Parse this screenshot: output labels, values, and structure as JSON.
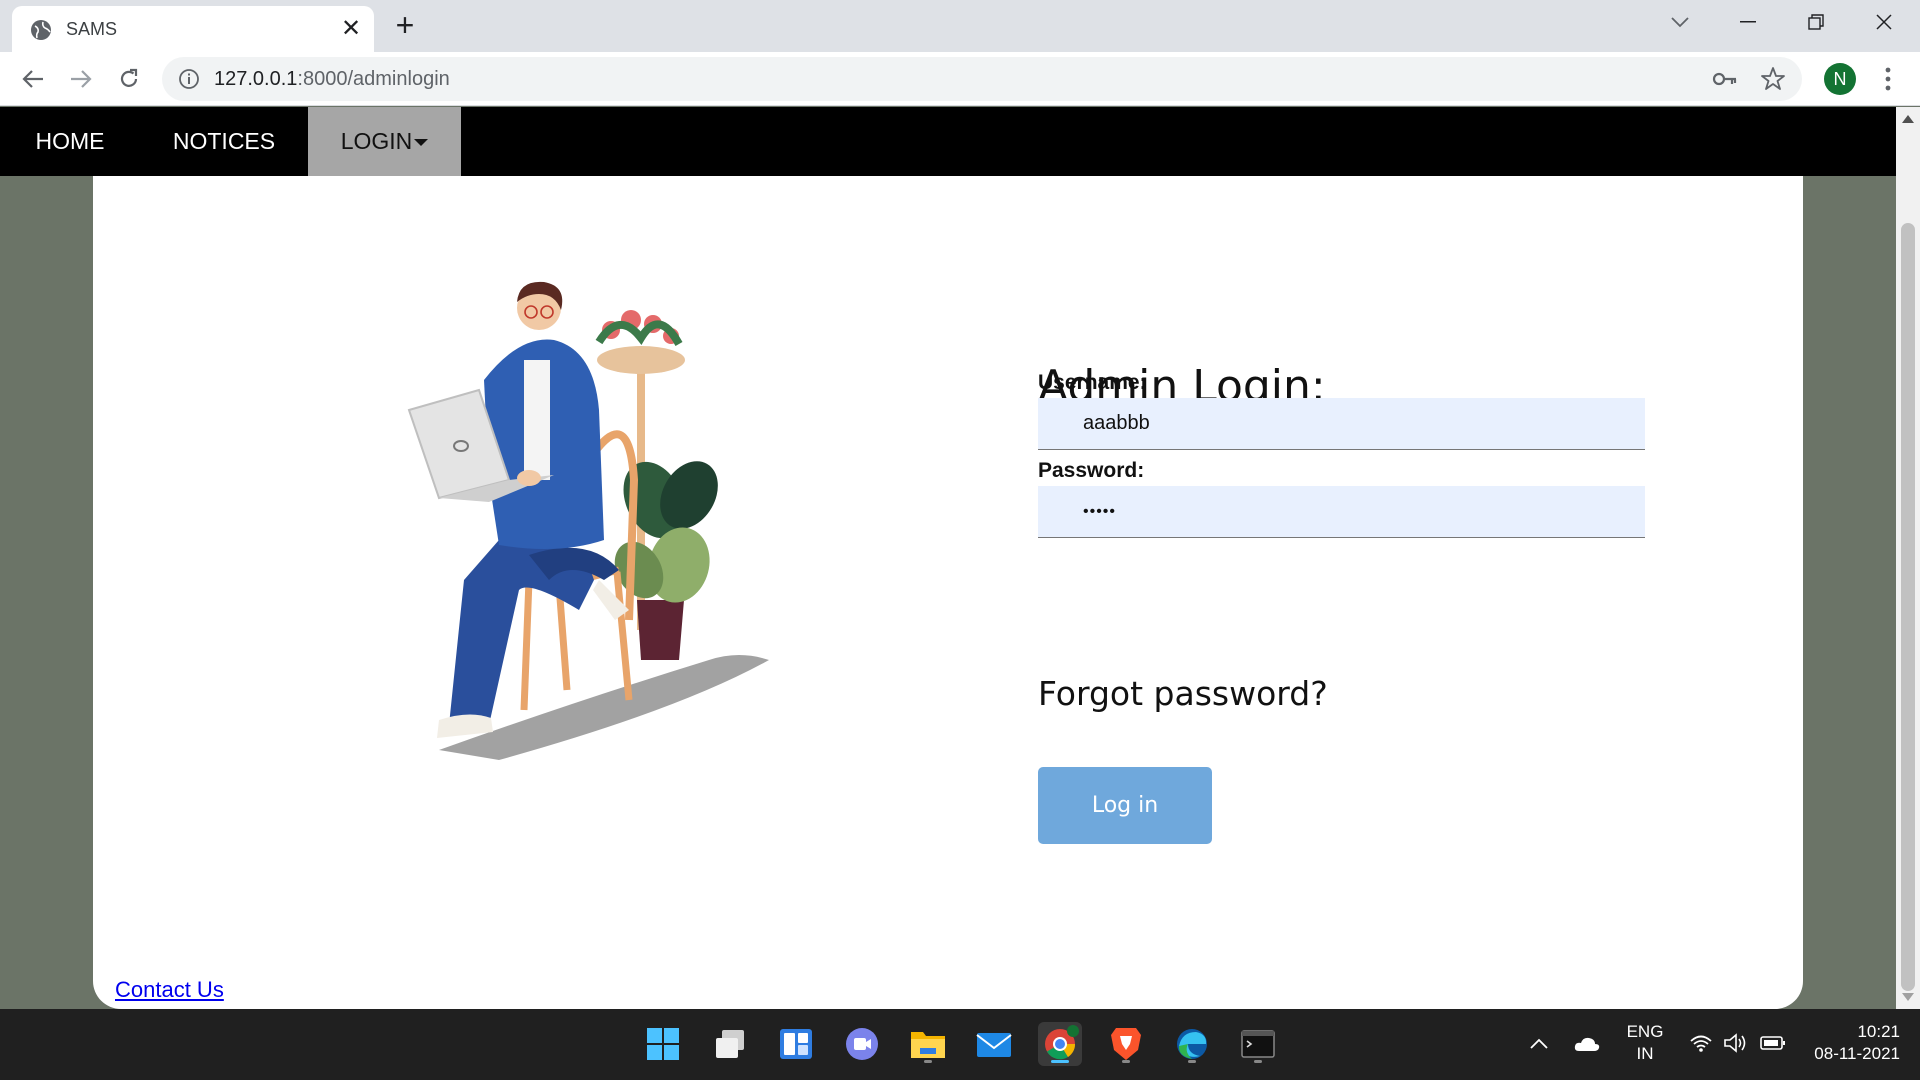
{
  "browser": {
    "tab_title": "SAMS",
    "url_host": "127.0.0.1",
    "url_path": ":8000/adminlogin",
    "profile_initial": "N"
  },
  "site_nav": {
    "items": [
      {
        "label": "HOME"
      },
      {
        "label": "NOTICES"
      },
      {
        "label": "LOGIN"
      }
    ]
  },
  "login": {
    "title": "Admin Login:",
    "username_label": "Username:",
    "username_value": "aaabbb",
    "password_label": "Password:",
    "password_value": "•••••",
    "forgot_label": "Forgot password?",
    "submit_label": "Log in"
  },
  "footer": {
    "contact_label": "Contact Us"
  },
  "taskbar": {
    "apps": [
      "start-icon",
      "task-view-icon",
      "widgets-icon",
      "teams-chat-icon",
      "file-explorer-icon",
      "mail-icon",
      "chrome-icon",
      "brave-icon",
      "edge-icon",
      "terminal-icon"
    ],
    "lang_line1": "ENG",
    "lang_line2": "IN",
    "time": "10:21",
    "date": "08-11-2021"
  },
  "colors": {
    "nav_bg": "#000000",
    "nav_active": "#a6a6a6",
    "button": "#6fa8dc",
    "input_bg": "#e8f0fe",
    "page_bg": "#6b7467"
  }
}
